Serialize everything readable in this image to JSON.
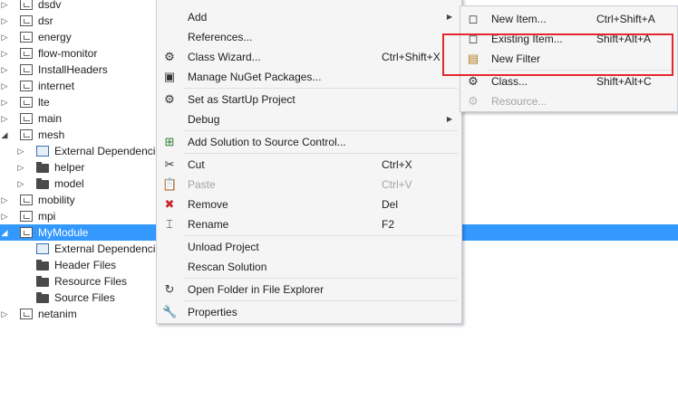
{
  "tree": {
    "rows": [
      {
        "label": "dsdv",
        "expander": "▷",
        "icon": "project",
        "indent": 0
      },
      {
        "label": "dsr",
        "expander": "▷",
        "icon": "project",
        "indent": 0
      },
      {
        "label": "energy",
        "expander": "▷",
        "icon": "project",
        "indent": 0
      },
      {
        "label": "flow-monitor",
        "expander": "▷",
        "icon": "project",
        "indent": 0
      },
      {
        "label": "InstallHeaders",
        "expander": "▷",
        "icon": "project",
        "indent": 0
      },
      {
        "label": "internet",
        "expander": "▷",
        "icon": "project",
        "indent": 0
      },
      {
        "label": "lte",
        "expander": "▷",
        "icon": "project",
        "indent": 0
      },
      {
        "label": "main",
        "expander": "▷",
        "icon": "project",
        "indent": 0
      },
      {
        "label": "mesh",
        "expander": "◢",
        "icon": "project",
        "indent": 0
      },
      {
        "label": "External Dependencies",
        "expander": "▷",
        "icon": "dependencies",
        "indent": 1
      },
      {
        "label": "helper",
        "expander": "▷",
        "icon": "folder",
        "indent": 1
      },
      {
        "label": "model",
        "expander": "▷",
        "icon": "folder",
        "indent": 1
      },
      {
        "label": "mobility",
        "expander": "▷",
        "icon": "project",
        "indent": 0
      },
      {
        "label": "mpi",
        "expander": "▷",
        "icon": "project",
        "indent": 0
      },
      {
        "label": "MyModule",
        "expander": "◢",
        "icon": "project",
        "indent": 0,
        "selected": true
      },
      {
        "label": "External Dependencies",
        "expander": "",
        "icon": "dependencies",
        "indent": 1
      },
      {
        "label": "Header Files",
        "expander": "",
        "icon": "folder",
        "indent": 1
      },
      {
        "label": "Resource Files",
        "expander": "",
        "icon": "folder",
        "indent": 1
      },
      {
        "label": "Source Files",
        "expander": "",
        "icon": "folder",
        "indent": 1
      },
      {
        "label": "netanim",
        "expander": "▷",
        "icon": "project",
        "indent": 0
      }
    ]
  },
  "context_menu": {
    "items": [
      {
        "label": "Add",
        "shortcut": "",
        "icon": "",
        "submenu": true,
        "disabled": false,
        "name": "menu-add"
      },
      {
        "label": "References...",
        "shortcut": "",
        "icon": "",
        "submenu": false,
        "disabled": false,
        "name": "menu-references"
      },
      {
        "label": "Class Wizard...",
        "shortcut": "Ctrl+Shift+X",
        "icon": "class-wizard-icon",
        "submenu": false,
        "disabled": false,
        "name": "menu-class-wizard"
      },
      {
        "label": "Manage NuGet Packages...",
        "shortcut": "",
        "icon": "nuget-icon",
        "submenu": false,
        "disabled": false,
        "name": "menu-manage-nuget"
      },
      {
        "sep": true
      },
      {
        "label": "Set as StartUp Project",
        "shortcut": "",
        "icon": "gear-icon",
        "submenu": false,
        "disabled": false,
        "name": "menu-set-startup"
      },
      {
        "label": "Debug",
        "shortcut": "",
        "icon": "",
        "submenu": true,
        "disabled": false,
        "name": "menu-debug"
      },
      {
        "sep": true
      },
      {
        "label": "Add Solution to Source Control...",
        "shortcut": "",
        "icon": "source-control-icon",
        "submenu": false,
        "disabled": false,
        "name": "menu-add-source-control"
      },
      {
        "sep": true
      },
      {
        "label": "Cut",
        "shortcut": "Ctrl+X",
        "icon": "scissors-icon",
        "submenu": false,
        "disabled": false,
        "name": "menu-cut"
      },
      {
        "label": "Paste",
        "shortcut": "Ctrl+V",
        "icon": "paste-icon",
        "submenu": false,
        "disabled": true,
        "name": "menu-paste"
      },
      {
        "label": "Remove",
        "shortcut": "Del",
        "icon": "remove-icon",
        "submenu": false,
        "disabled": false,
        "name": "menu-remove"
      },
      {
        "label": "Rename",
        "shortcut": "F2",
        "icon": "rename-icon",
        "submenu": false,
        "disabled": false,
        "name": "menu-rename"
      },
      {
        "sep": true
      },
      {
        "label": "Unload Project",
        "shortcut": "",
        "icon": "",
        "submenu": false,
        "disabled": false,
        "name": "menu-unload-project"
      },
      {
        "label": "Rescan Solution",
        "shortcut": "",
        "icon": "",
        "submenu": false,
        "disabled": false,
        "name": "menu-rescan-solution"
      },
      {
        "sep": true
      },
      {
        "label": "Open Folder in File Explorer",
        "shortcut": "",
        "icon": "open-folder-icon",
        "submenu": false,
        "disabled": false,
        "name": "menu-open-folder"
      },
      {
        "sep": true
      },
      {
        "label": "Properties",
        "shortcut": "",
        "icon": "wrench-icon",
        "submenu": false,
        "disabled": false,
        "name": "menu-properties"
      }
    ]
  },
  "add_submenu": {
    "items": [
      {
        "label": "New Item...",
        "shortcut": "Ctrl+Shift+A",
        "icon": "new-item-icon",
        "disabled": false,
        "name": "submenu-new-item"
      },
      {
        "label": "Existing Item...",
        "shortcut": "Shift+Alt+A",
        "icon": "existing-item-icon",
        "disabled": false,
        "name": "submenu-existing-item"
      },
      {
        "label": "New Filter",
        "shortcut": "",
        "icon": "new-filter-icon",
        "disabled": false,
        "name": "submenu-new-filter"
      },
      {
        "sep": true
      },
      {
        "label": "Class...",
        "shortcut": "Shift+Alt+C",
        "icon": "class-icon",
        "disabled": false,
        "name": "submenu-class"
      },
      {
        "label": "Resource...",
        "shortcut": "",
        "icon": "resource-icon",
        "disabled": true,
        "name": "submenu-resource"
      }
    ]
  },
  "highlight_color": "#e0282e",
  "selection_color": "#3399ff"
}
